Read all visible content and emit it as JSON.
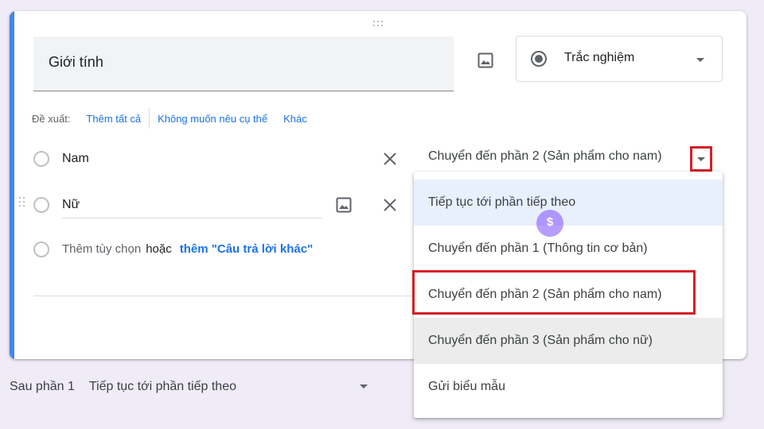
{
  "question": {
    "title": "Giới tính",
    "type_label": "Trắc nghiệm",
    "type_icon": "radio-filled-icon"
  },
  "suggestions": {
    "label": "Đề xuất:",
    "items": [
      "Thêm tất cả",
      "Không muốn nêu cụ thể",
      "Khác"
    ]
  },
  "options": [
    {
      "label": "Nam",
      "go_to": "Chuyển đến phần 2 (Sản phẩm cho nam)"
    },
    {
      "label": "Nữ"
    }
  ],
  "add_option": {
    "placeholder": "Thêm tùy chọn",
    "or": "hoặc",
    "other_link": "thêm \"Câu trả lời khác\""
  },
  "dropdown_menu": {
    "items": [
      "Tiếp tục tới phần tiếp theo",
      "Chuyển đến phần 1 (Thông tin cơ bản)",
      "Chuyển đến phần 2 (Sản phẩm cho nam)",
      "Chuyển đến phần 3 (Sản phẩm cho nữ)",
      "Gửi biểu mẫu"
    ],
    "highlighted_index": 0,
    "boxed_index": 2,
    "hover_index": 3
  },
  "after_section": {
    "label": "Sau phần 1",
    "value": "Tiếp tục tới phần tiếp theo"
  },
  "colors": {
    "accent": "#4285f4",
    "link": "#1a73e8",
    "highlight_box": "#d61f26",
    "page_bg": "#efebf7"
  }
}
